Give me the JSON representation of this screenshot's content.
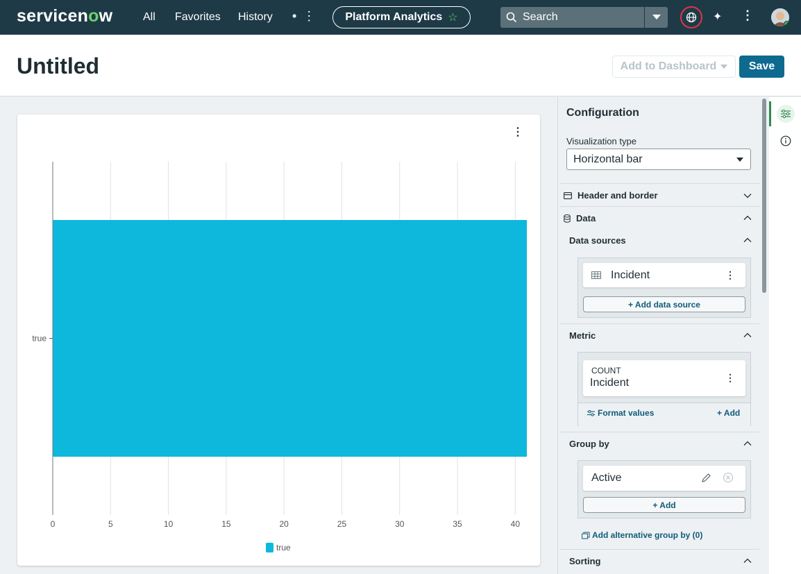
{
  "nav": {
    "logo_prefix": "servicen",
    "logo_o": "o",
    "logo_suffix": "w",
    "all": "All",
    "favorites": "Favorites",
    "history": "History",
    "more": "• ⋮",
    "app_pill": "Platform Analytics",
    "search_placeholder": "Search"
  },
  "header": {
    "title": "Untitled",
    "add_to_dashboard": "Add to Dashboard",
    "save": "Save"
  },
  "chart_data": {
    "type": "bar",
    "orientation": "horizontal",
    "categories": [
      "true"
    ],
    "values": [
      41
    ],
    "x_ticks": [
      0,
      5,
      10,
      15,
      20,
      25,
      30,
      35,
      40
    ],
    "xlim": [
      0,
      41
    ],
    "legend": [
      "true"
    ],
    "legend_position": "bottom",
    "grid": true,
    "bar_color": "#0db8dc"
  },
  "config": {
    "title": "Configuration",
    "viz_type_label": "Visualization type",
    "viz_type_value": "Horizontal bar",
    "header_border": "Header and border",
    "data": "Data",
    "data_sources": "Data sources",
    "source_name": "Incident",
    "add_data_source": "+ Add data source",
    "metric": "Metric",
    "metric_agg": "COUNT",
    "metric_table": "Incident",
    "format_values": "Format values",
    "metric_add": "+ Add",
    "group_by": "Group by",
    "group_field": "Active",
    "group_add": "+ Add",
    "alt_group_by": "Add alternative group by (0)",
    "sorting": "Sorting"
  }
}
